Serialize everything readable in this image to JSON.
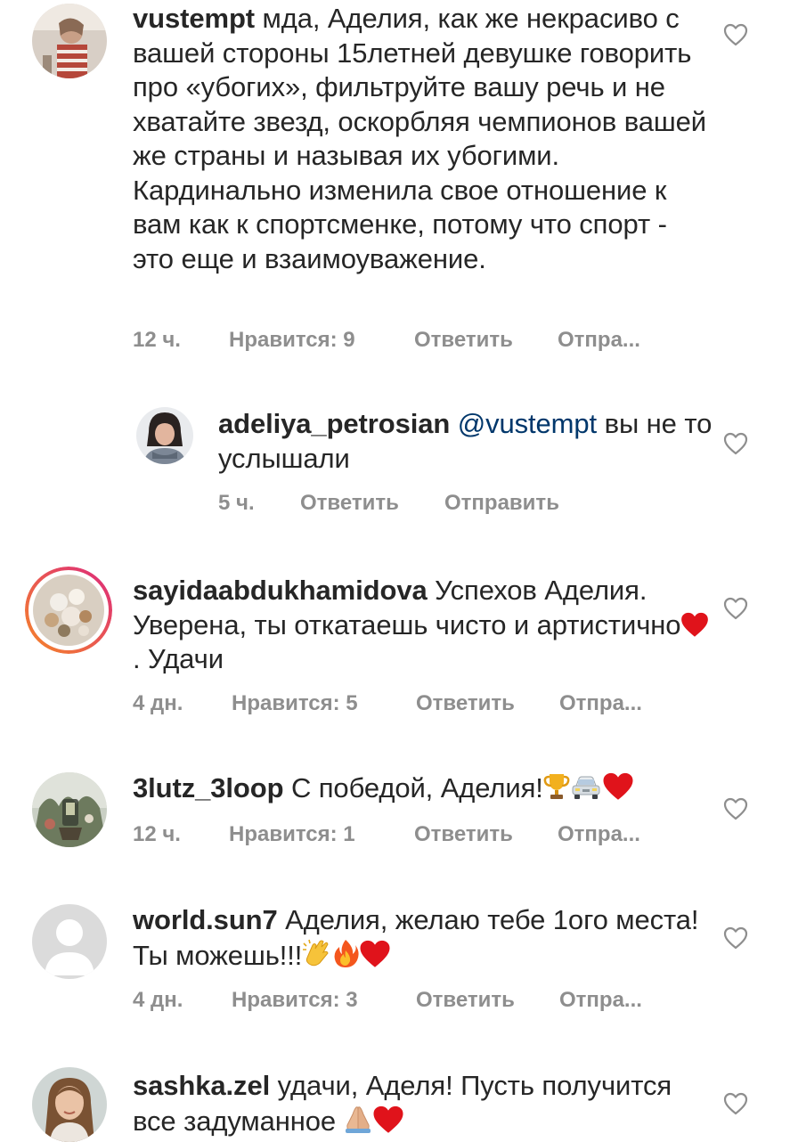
{
  "comments": [
    {
      "username": "vustempt",
      "text": "мда, Аделия, как же некрасиво с вашей стороны 15летней девушке говорить про «убогих», фильтруйте вашу речь и не хватайте звезд, оскорбляя чемпионов вашей же страны и называя их убогими. Кардинально изменила свое отношение к вам как к спортсменке, потому что спорт - это еще и взаимоуважение.",
      "time": "12 ч.",
      "likes": "Нравится: 9",
      "reply": "Ответить",
      "send": "Отпра..."
    },
    {
      "username": "adeliya_petrosian",
      "mention": "@vustempt",
      "text": "вы не то услышали",
      "time": "5 ч.",
      "reply": "Ответить",
      "send": "Отправить"
    },
    {
      "username": "sayidaabdukhamidova",
      "text": "Успехов Аделия. Уверена, ты откатаешь чисто и артистично",
      "text_after": ". Удачи",
      "time": "4 дн.",
      "likes": "Нравится: 5",
      "reply": "Ответить",
      "send": "Отпра..."
    },
    {
      "username": "3lutz_3loop",
      "text": "С победой, Аделия!",
      "time": "12 ч.",
      "likes": "Нравится: 1",
      "reply": "Ответить",
      "send": "Отпра..."
    },
    {
      "username": "world.sun7",
      "text": "Аделия, желаю тебе 1ого места! Ты можешь!!!",
      "time": "4 дн.",
      "likes": "Нравится: 3",
      "reply": "Ответить",
      "send": "Отпра..."
    },
    {
      "username": "sashka.zel",
      "text": "удачи, Аделя! Пусть получится все задуманное",
      "time": "",
      "likes": "",
      "reply": "",
      "send": ""
    }
  ],
  "colors": {
    "text": "#262626",
    "meta": "#8e8e8e",
    "mention": "#00376b",
    "story_ring_start": "#f58529",
    "story_ring_end": "#dd2a7b",
    "heart_emoji": "#e0131b"
  },
  "icons": {
    "like": "heart-outline-icon",
    "emoji_heart": "red-heart-emoji",
    "emoji_trophy": "trophy-emoji",
    "emoji_car": "car-emoji",
    "emoji_clap": "clapping-hands-emoji",
    "emoji_fire": "fire-emoji",
    "emoji_pray": "folded-hands-emoji"
  }
}
